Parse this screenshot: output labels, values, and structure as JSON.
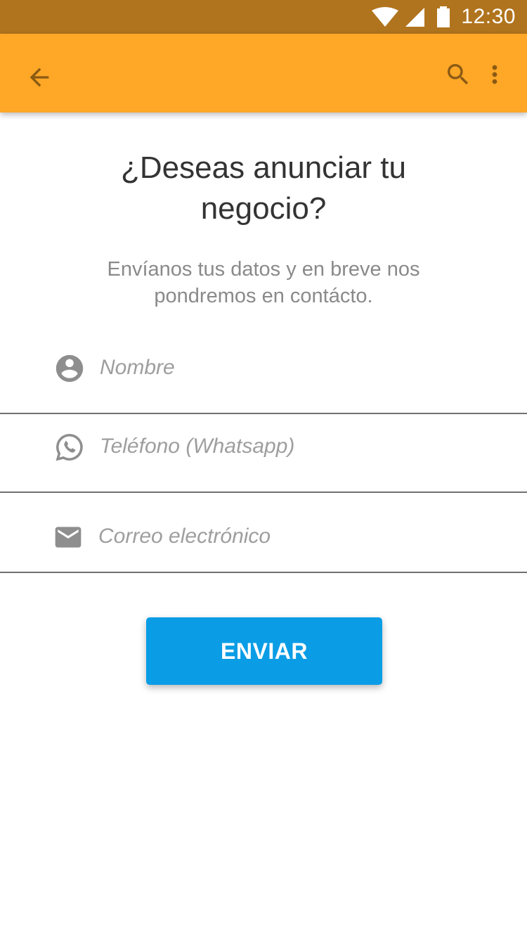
{
  "status_bar": {
    "time": "12:30"
  },
  "app_bar": {
    "icons": {
      "back": "arrow-back-icon",
      "search": "search-icon",
      "more": "more-vert-icon"
    },
    "icon_color": "#8A5A13",
    "background": "#FFA726"
  },
  "content": {
    "title_line1": "¿Deseas anunciar tu",
    "title_line2": "negocio?",
    "subtitle_line1": "Envíanos tus datos y en breve nos",
    "subtitle_line2": "pondremos en contácto."
  },
  "form": {
    "fields": [
      {
        "icon": "account-circle-icon",
        "placeholder": "Nombre",
        "value": ""
      },
      {
        "icon": "whatsapp-icon",
        "placeholder": "Teléfono (Whatsapp)",
        "value": ""
      },
      {
        "icon": "email-icon",
        "placeholder": "Correo electrónico",
        "value": ""
      }
    ],
    "submit_label": "ENVIAR",
    "submit_color": "#0A9DE6"
  }
}
